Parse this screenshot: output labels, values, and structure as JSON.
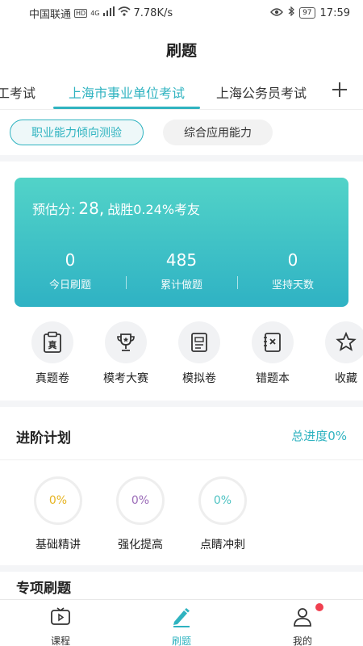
{
  "status_bar": {
    "carrier": "中国联通",
    "hd_badge": "HD",
    "net_type": "4G",
    "speed": "7.78K/s",
    "battery": "97",
    "time": "17:59"
  },
  "header": {
    "title": "刷题"
  },
  "exam_tabs": {
    "items": [
      "工考试",
      "上海市事业单位考试",
      "上海公务员考试"
    ],
    "active_index": 1
  },
  "subject_pills": {
    "items": [
      "职业能力倾向测验",
      "综合应用能力"
    ],
    "active_index": 0
  },
  "score_card": {
    "estimate_label": "预估分:",
    "estimate_value": "28,",
    "rank_text": "战胜0.24%考友",
    "stats": [
      {
        "value": "0",
        "label": "今日刷题"
      },
      {
        "value": "485",
        "label": "累计做题"
      },
      {
        "value": "0",
        "label": "坚持天数"
      }
    ],
    "gradient_colors": [
      "#52d3c8",
      "#2fb2c4"
    ]
  },
  "quick_actions": [
    {
      "label": "真题卷",
      "icon": "paper-clipboard-icon",
      "glyph": "真"
    },
    {
      "label": "模考大赛",
      "icon": "trophy-icon"
    },
    {
      "label": "模拟卷",
      "icon": "document-icon"
    },
    {
      "label": "错题本",
      "icon": "wrong-book-icon"
    },
    {
      "label": "收藏",
      "icon": "star-icon"
    }
  ],
  "plan": {
    "title": "进阶计划",
    "progress_text": "总进度0%",
    "items": [
      {
        "label": "基础精讲",
        "percent": "0%",
        "color": "#e6b422"
      },
      {
        "label": "强化提高",
        "percent": "0%",
        "color": "#9b6bb8"
      },
      {
        "label": "点睛冲刺",
        "percent": "0%",
        "color": "#4fc3c3"
      }
    ]
  },
  "next_section_title": "专项刷题",
  "bottom_nav": {
    "items": [
      {
        "label": "课程",
        "icon": "tv-icon"
      },
      {
        "label": "刷题",
        "icon": "pencil-icon"
      },
      {
        "label": "我的",
        "icon": "user-icon"
      }
    ],
    "active_index": 1
  },
  "colors": {
    "accent": "#2fb3c0",
    "badge": "#f04050"
  }
}
